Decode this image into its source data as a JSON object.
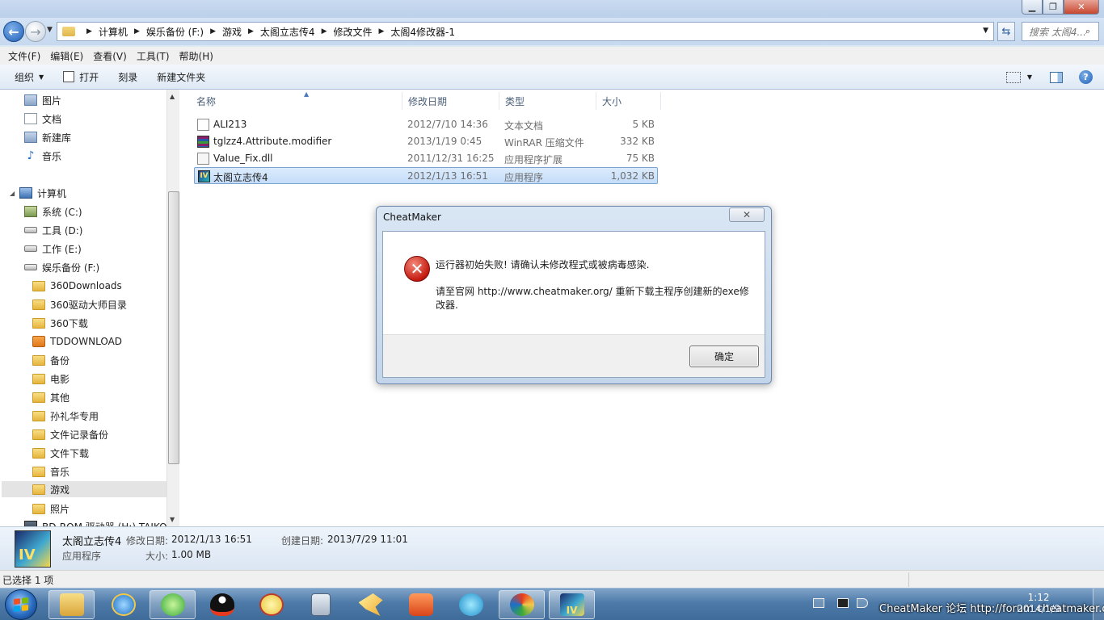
{
  "window": {
    "minimize_glyph": "▁",
    "maximize_glyph": "❐",
    "close_glyph": "✕"
  },
  "address": {
    "breadcrumbs": [
      "计算机",
      "娱乐备份 (F:)",
      "游戏",
      "太阁立志传4",
      "修改文件",
      "太阁4修改器-1"
    ],
    "search_placeholder": "搜索 太阁4..."
  },
  "menubar": {
    "items": [
      "文件(F)",
      "编辑(E)",
      "查看(V)",
      "工具(T)",
      "帮助(H)"
    ]
  },
  "toolbar": {
    "organize_label": "组织",
    "open_label": "打开",
    "burn_label": "刻录",
    "new_folder_label": "新建文件夹"
  },
  "navpane": {
    "libraries": [
      "图片",
      "文档",
      "新建库",
      "音乐"
    ],
    "computer_label": "计算机",
    "drives": [
      "系统 (C:)",
      "工具 (D:)",
      "工作 (E:)",
      "娱乐备份 (F:)"
    ],
    "folders": [
      "360Downloads",
      "360驱动大师目录",
      "360下载",
      "TDDOWNLOAD",
      "备份",
      "电影",
      "其他",
      "孙礼华专用",
      "文件记录备份",
      "文件下载",
      "音乐",
      "游戏",
      "照片"
    ],
    "rom_drive": "BD-ROM 驱动器 (H:) TAIKO"
  },
  "filelist": {
    "columns": [
      "名称",
      "修改日期",
      "类型",
      "大小"
    ],
    "rows": [
      {
        "name": "ALI213",
        "date": "2012/7/10 14:36",
        "type": "文本文档",
        "size": "5 KB"
      },
      {
        "name": "tglzz4.Attribute.modifier",
        "date": "2013/1/19 0:45",
        "type": "WinRAR 压缩文件",
        "size": "332 KB"
      },
      {
        "name": "Value_Fix.dll",
        "date": "2011/12/31 16:25",
        "type": "应用程序扩展",
        "size": "75 KB"
      },
      {
        "name": "太阁立志传4",
        "date": "2012/1/13 16:51",
        "type": "应用程序",
        "size": "1,032 KB"
      }
    ],
    "selected_index": 3
  },
  "dialog": {
    "title": "CheatMaker",
    "message_line1": "运行器初始失败! 请确认未修改程式或被病毒感染.",
    "message_line2": "请至官网 http://www.cheatmaker.org/ 重新下载主程序创建新的exe修改器.",
    "ok_label": "确定",
    "close_glyph": "✕"
  },
  "details": {
    "name": "太阁立志传4",
    "type": "应用程序",
    "modified_label": "修改日期:",
    "modified_value": "2012/1/13 16:51",
    "size_label": "大小:",
    "size_value": "1.00 MB",
    "created_label": "创建日期:",
    "created_value": "2013/7/29 11:01",
    "thumb_text": "IV"
  },
  "statusbar": {
    "text": "已选择 1 项"
  },
  "taskbar": {
    "clock_time": "1:12",
    "clock_date": "2014/1/9",
    "watermark": "CheatMaker 论坛 http://forum.cheatmaker.org/",
    "running_app_text": "IV"
  },
  "colors": {
    "selection_bg": "#cfe3fa",
    "selection_border": "#7da2ce",
    "taskbar": "#4d7aa8",
    "error_red": "#c41a10"
  }
}
